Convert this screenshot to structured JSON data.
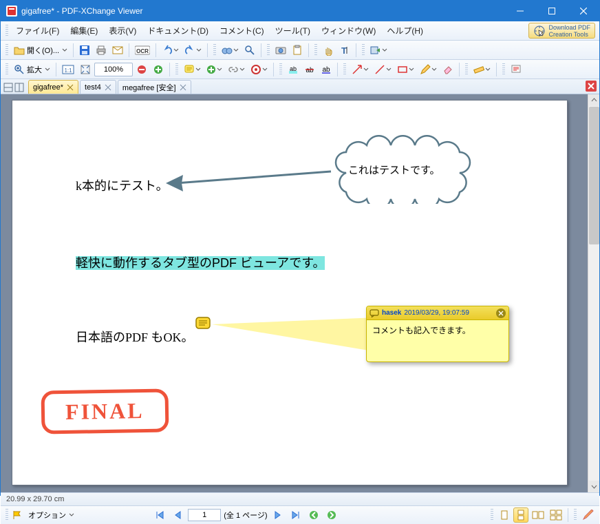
{
  "window": {
    "title": "gigafree* - PDF-XChange Viewer"
  },
  "menu": {
    "file": "ファイル(F)",
    "edit": "編集(E)",
    "view": "表示(V)",
    "document": "ドキュメント(D)",
    "comment": "コメント(C)",
    "tool": "ツール(T)",
    "window": "ウィンドウ(W)",
    "help": "ヘルプ(H)",
    "download_btn": "Download PDF\nCreation Tools"
  },
  "toolbar1": {
    "open_label": "開く(O)..."
  },
  "toolbar2": {
    "zoom_label": "拡大",
    "zoom_value": "100%"
  },
  "tabs": [
    {
      "label": "gigafree*"
    },
    {
      "label": "test4"
    },
    {
      "label": "megafree [安全]"
    }
  ],
  "doc": {
    "text1": "k本的にテスト。",
    "callout": "これはテストです。",
    "text2": "軽快に動作するタブ型のPDF ビューアです。",
    "text3": "日本語のPDF もOK。",
    "comment_author": "hasek",
    "comment_date": "2019/03/29, 19:07:59",
    "comment_body": "コメントも記入できます。",
    "stamp": "FINAL"
  },
  "status": {
    "dims": "20.99 x 29.70 cm"
  },
  "nav": {
    "options_label": "オプション",
    "current_page": "1",
    "page_info": "(全 1 ページ)"
  }
}
